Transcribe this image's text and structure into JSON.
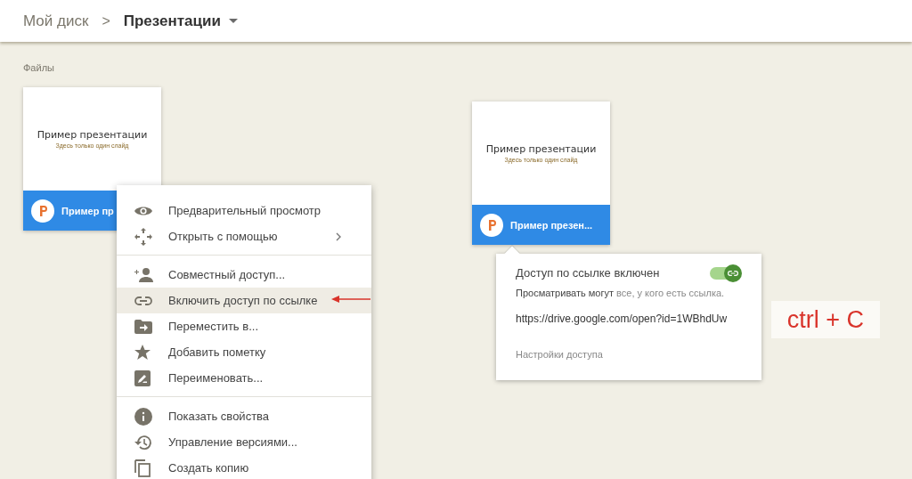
{
  "breadcrumb": {
    "root": "Мой диск",
    "separator": ">",
    "current": "Презентации"
  },
  "section_label": "Файлы",
  "files": [
    {
      "thumbnail_title": "Пример презентации",
      "thumbnail_subtitle": "Здесь только один слайд",
      "name": "Пример пр",
      "selected": true
    },
    {
      "thumbnail_title": "Пример презентации",
      "thumbnail_subtitle": "Здесь только один слайд",
      "name": "Пример презен...",
      "selected": true
    }
  ],
  "context_menu": {
    "groups": [
      [
        {
          "label": "Предварительный просмотр",
          "highlighted": false,
          "submenu": false
        },
        {
          "label": "Открыть с помощью",
          "highlighted": false,
          "submenu": true
        }
      ],
      [
        {
          "label": "Совместный доступ...",
          "highlighted": false,
          "submenu": false
        },
        {
          "label": "Включить доступ по ссылке",
          "highlighted": true,
          "submenu": false
        },
        {
          "label": "Переместить в...",
          "highlighted": false,
          "submenu": false
        },
        {
          "label": "Добавить пометку",
          "highlighted": false,
          "submenu": false
        },
        {
          "label": "Переименовать...",
          "highlighted": false,
          "submenu": false
        }
      ],
      [
        {
          "label": "Показать свойства",
          "highlighted": false,
          "submenu": false
        },
        {
          "label": "Управление версиями...",
          "highlighted": false,
          "submenu": false
        },
        {
          "label": "Создать копию",
          "highlighted": false,
          "submenu": false
        }
      ]
    ]
  },
  "link_popup": {
    "title": "Доступ по ссылке включен",
    "on": true,
    "description": "**Просматривать могут** все, у кого есть ссылка.",
    "url": "https://drive.google.com/open?id=1WBhdUw",
    "settings_link": "Настройки доступа"
  },
  "annotation": {
    "shortcut": "ctrl + C"
  }
}
